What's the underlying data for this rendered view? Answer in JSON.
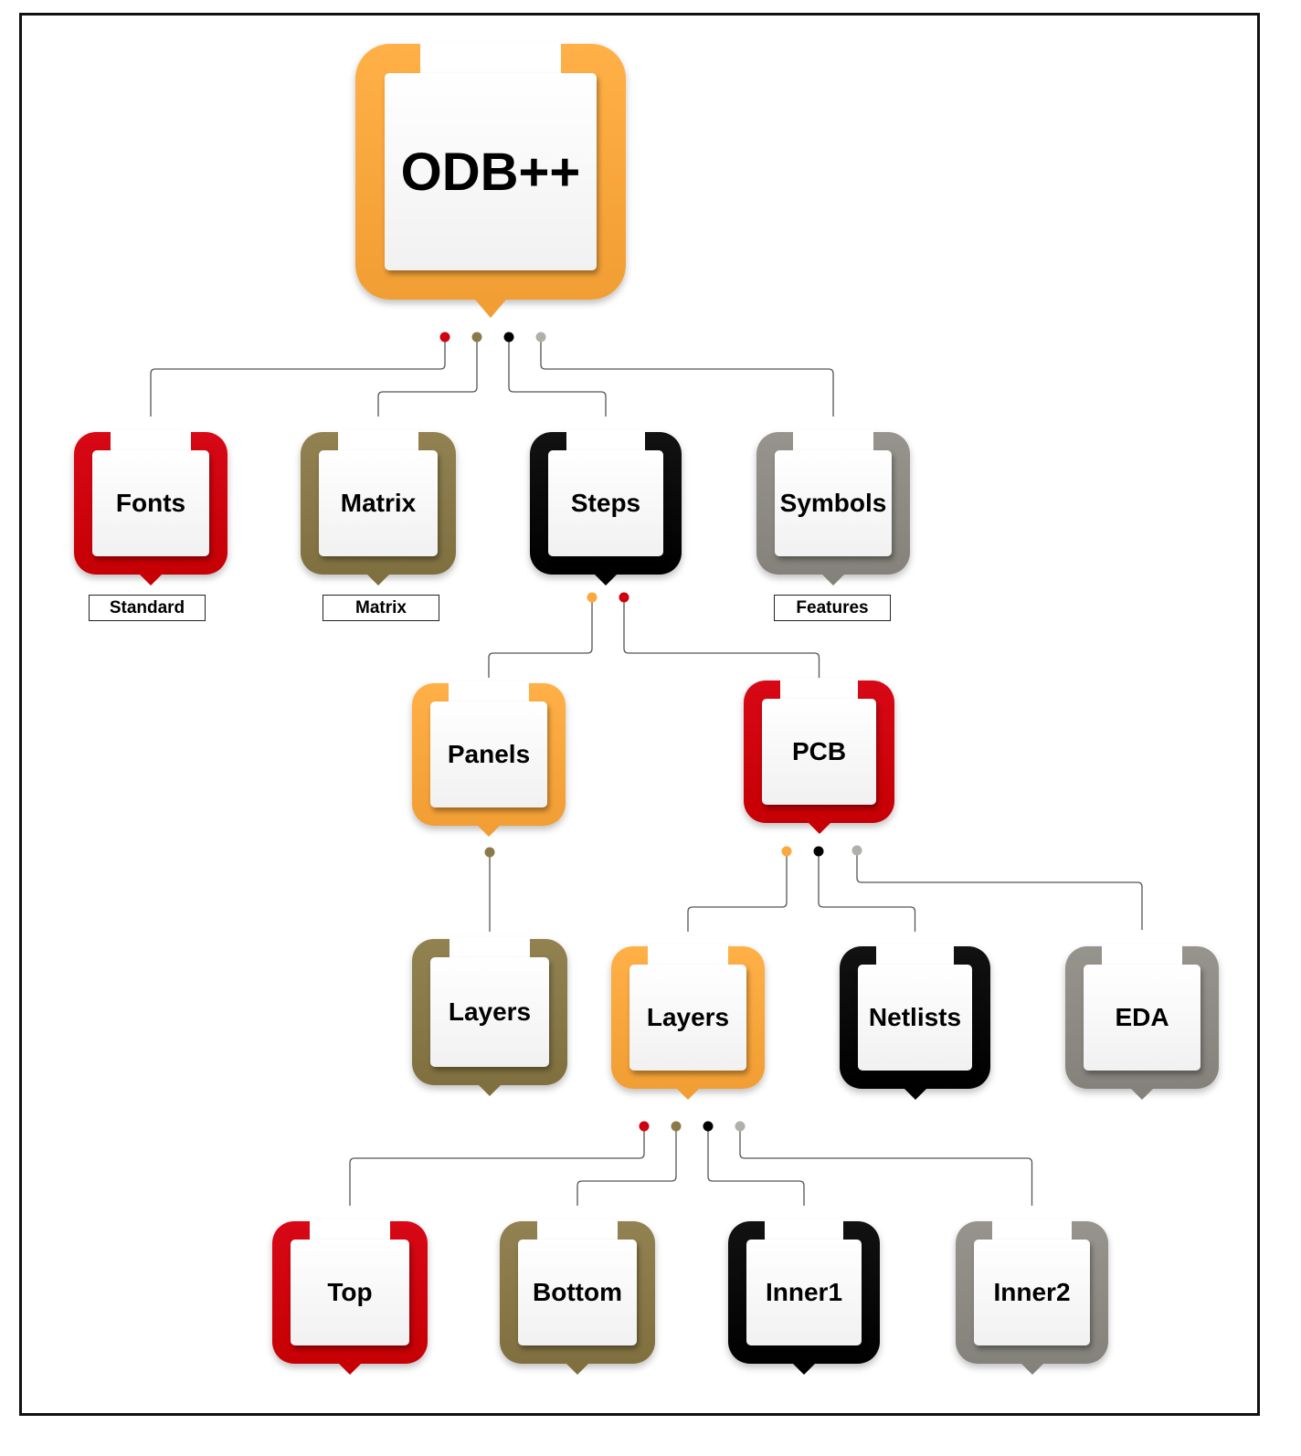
{
  "palette": {
    "orange": "#FBA83E",
    "red": "#D0000E",
    "olive": "#8A7A4A",
    "black": "#0A0A0A",
    "gray": "#8E8C85"
  },
  "root": {
    "id": "odb",
    "label": "ODB++",
    "color": "orange"
  },
  "nodes": [
    {
      "id": "odb",
      "label": "ODB++",
      "color": "orange",
      "parent": null
    },
    {
      "id": "fonts",
      "label": "Fonts",
      "color": "red",
      "parent": "odb",
      "dot": "red",
      "tag": "Standard"
    },
    {
      "id": "matrix",
      "label": "Matrix",
      "color": "olive",
      "parent": "odb",
      "dot": "olive",
      "tag": "Matrix"
    },
    {
      "id": "steps",
      "label": "Steps",
      "color": "black",
      "parent": "odb",
      "dot": "black"
    },
    {
      "id": "symbols",
      "label": "Symbols",
      "color": "gray",
      "parent": "odb",
      "dot": "gray",
      "tag": "Features"
    },
    {
      "id": "panels",
      "label": "Panels",
      "color": "orange",
      "parent": "steps",
      "dot": "orange"
    },
    {
      "id": "pcb",
      "label": "PCB",
      "color": "red",
      "parent": "steps",
      "dot": "red"
    },
    {
      "id": "panel-layers",
      "label": "Layers",
      "color": "olive",
      "parent": "panels",
      "dot": "olive"
    },
    {
      "id": "pcb-layers",
      "label": "Layers",
      "color": "orange",
      "parent": "pcb",
      "dot": "orange"
    },
    {
      "id": "netlists",
      "label": "Netlists",
      "color": "black",
      "parent": "pcb",
      "dot": "black"
    },
    {
      "id": "eda",
      "label": "EDA",
      "color": "gray",
      "parent": "pcb",
      "dot": "gray"
    },
    {
      "id": "top",
      "label": "Top",
      "color": "red",
      "parent": "pcb-layers",
      "dot": "red"
    },
    {
      "id": "bottom",
      "label": "Bottom",
      "color": "olive",
      "parent": "pcb-layers",
      "dot": "olive"
    },
    {
      "id": "inner1",
      "label": "Inner1",
      "color": "black",
      "parent": "pcb-layers",
      "dot": "black"
    },
    {
      "id": "inner2",
      "label": "Inner2",
      "color": "gray",
      "parent": "pcb-layers",
      "dot": "gray"
    }
  ]
}
